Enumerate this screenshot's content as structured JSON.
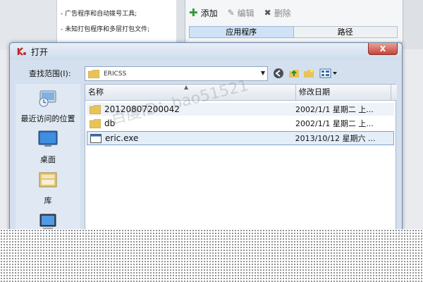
{
  "background_window": {
    "text_lines": [
      "- 广告程序和自动拨号工具;",
      "- 未知打包程序和多层打包文件;"
    ],
    "toolbar": {
      "add_label": "添加",
      "edit_label": "编辑",
      "delete_label": "删除"
    },
    "columns": [
      "应用程序",
      "路径"
    ]
  },
  "dialog": {
    "title": "打开",
    "close_label": "X",
    "look_in_label": "查找范围(I):",
    "look_in_value": "ERICSS",
    "places": [
      {
        "label": "最近访问的位置",
        "icon": "recent-places-icon"
      },
      {
        "label": "桌面",
        "icon": "desktop-icon"
      },
      {
        "label": "库",
        "icon": "libraries-icon"
      },
      {
        "label": "",
        "icon": "computer-icon"
      }
    ],
    "columns": {
      "name": "名称",
      "modified": "修改日期"
    },
    "files": [
      {
        "name": "20120807200042",
        "modified": "2002/1/1 星期二 上...",
        "type": "folder"
      },
      {
        "name": "db",
        "modified": "2002/1/1 星期二 上...",
        "type": "folder"
      },
      {
        "name": "eric.exe",
        "modified": "2013/10/12 星期六 ...",
        "type": "exe"
      }
    ]
  },
  "watermark": "百度ID：bao51521",
  "colors": {
    "accent": "#cfe3f6",
    "selection": "#e4eef9",
    "close": "#c7433a"
  }
}
